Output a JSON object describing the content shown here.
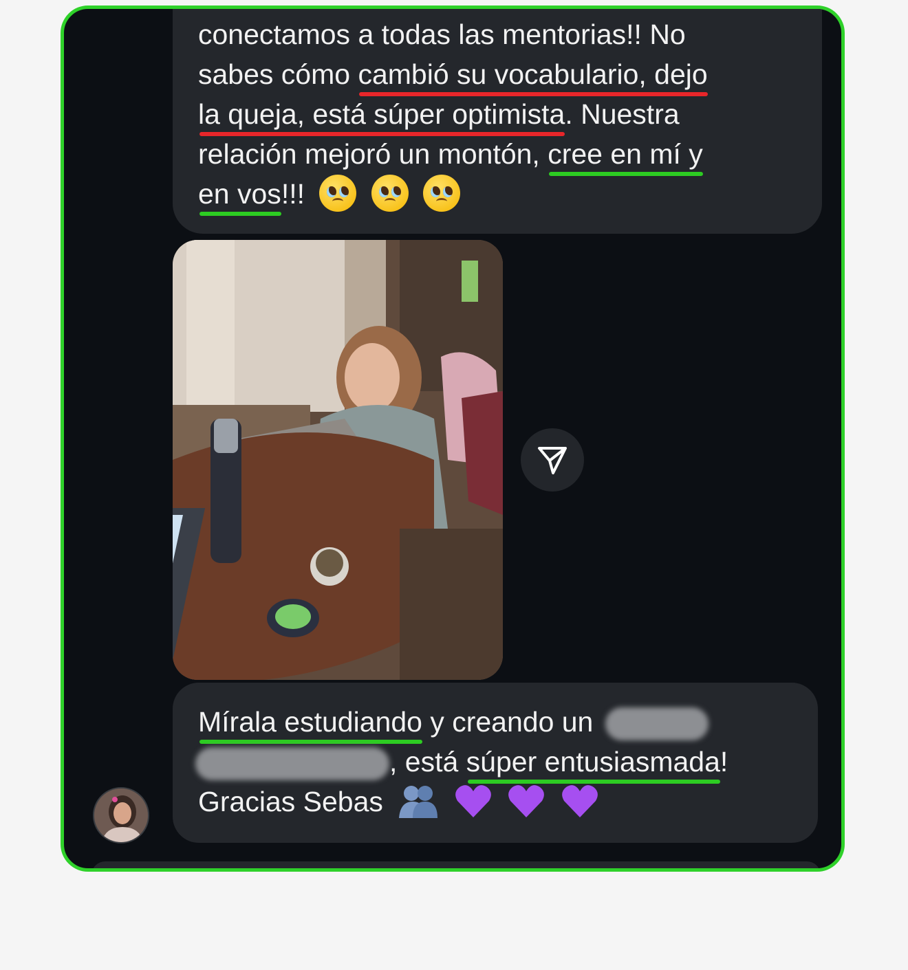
{
  "chat": {
    "message1": {
      "lines": [
        "conectamos a todas las mentorias!! No",
        "sabes cómo ",
        "cambió su vocabulario, dejo",
        "la queja, está súper optimista",
        ". Nuestra",
        "relación mejoró un montón, ",
        "cree en mí y",
        "en vos",
        "!!!"
      ]
    },
    "image": {
      "description_icon": "photo-attachment"
    },
    "share_icon": "send-arrow-icon",
    "message2": {
      "part1": "Mírala estudiando",
      "part2": " y creando un",
      "part3": ", está ",
      "part4": "súper entusiasmada",
      "part5": "!",
      "part6": "Gracias Sebas"
    }
  },
  "colors": {
    "frame_border": "#2fd12a",
    "chat_background": "#0c0f14",
    "bubble": "#24272c",
    "underline_red": "#e8262a",
    "underline_green": "#2dcc22",
    "heart": "#a64ff0"
  }
}
